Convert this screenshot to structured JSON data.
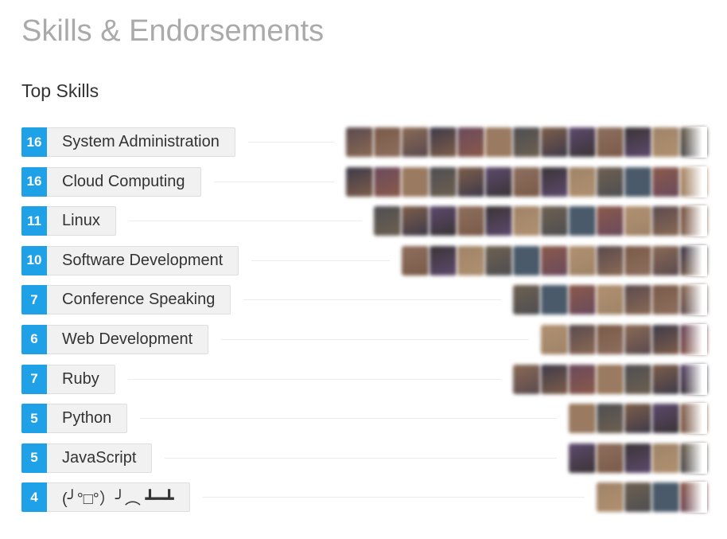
{
  "page": {
    "title": "Skills & Endorsements",
    "section_title": "Top Skills"
  },
  "skills": [
    {
      "count": "16",
      "name": "System Administration",
      "endorser_count": 13
    },
    {
      "count": "16",
      "name": "Cloud Computing",
      "endorser_count": 13
    },
    {
      "count": "11",
      "name": "Linux",
      "endorser_count": 12
    },
    {
      "count": "10",
      "name": "Software Development",
      "endorser_count": 11
    },
    {
      "count": "7",
      "name": "Conference Speaking",
      "endorser_count": 7
    },
    {
      "count": "6",
      "name": "Web Development",
      "endorser_count": 6
    },
    {
      "count": "7",
      "name": "Ruby",
      "endorser_count": 7
    },
    {
      "count": "5",
      "name": "Python",
      "endorser_count": 5
    },
    {
      "count": "5",
      "name": "JavaScript",
      "endorser_count": 5
    },
    {
      "count": "4",
      "name": "(╯°□°）╯︵ ┻━┻",
      "endorser_count": 4
    }
  ],
  "colors": {
    "accent": "#1ea1e6",
    "pill_background": "#f1f1f1",
    "page_title": "#aaaaaa",
    "text": "#333333"
  },
  "avatar_palette": [
    "#5a4a4e",
    "#7a5a48",
    "#8a6a55",
    "#3e3a4a",
    "#6b4a5e",
    "#9a7a60",
    "#4e4e52",
    "#7e5e4a",
    "#5e4a6e",
    "#8e6e5e",
    "#3a3436",
    "#a08468",
    "#6e6050",
    "#4a5a6a",
    "#8a5a4a",
    "#b09070"
  ]
}
